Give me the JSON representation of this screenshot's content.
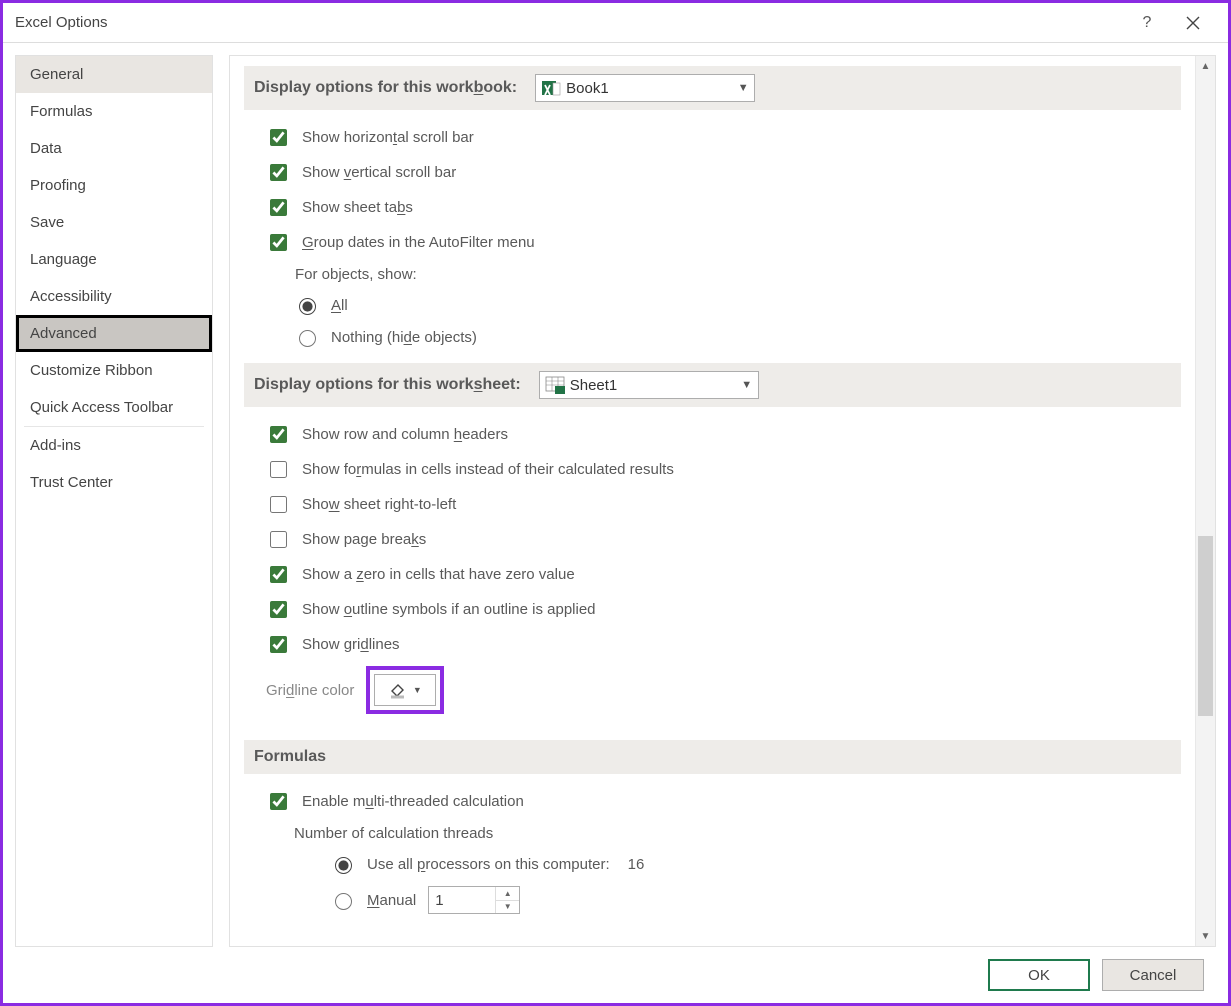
{
  "titlebar": {
    "title": "Excel Options"
  },
  "nav": {
    "general": "General",
    "formulas": "Formulas",
    "data": "Data",
    "proofing": "Proofing",
    "save": "Save",
    "language": "Language",
    "accessibility": "Accessibility",
    "advanced": "Advanced",
    "customize_ribbon": "Customize Ribbon",
    "qat": "Quick Access Toolbar",
    "addins": "Add-ins",
    "trust_center": "Trust Center"
  },
  "sec_workbook": {
    "title_a": "Display options for this work",
    "title_u": "b",
    "title_b": "ook:",
    "selected": "Book1",
    "show_h_scroll_a": "Show horizon",
    "show_h_scroll_u": "t",
    "show_h_scroll_b": "al scroll bar",
    "show_v_scroll_a": "Show ",
    "show_v_scroll_u": "v",
    "show_v_scroll_b": "ertical scroll bar",
    "show_tabs_a": "Show sheet ta",
    "show_tabs_u": "b",
    "show_tabs_b": "s",
    "group_dates_u": "G",
    "group_dates_b": "roup dates in the AutoFilter menu",
    "for_objects": "For objects, show:",
    "all_u": "A",
    "all_b": "ll",
    "nothing_a": "Nothing (hi",
    "nothing_u": "d",
    "nothing_b": "e objects)"
  },
  "sec_worksheet": {
    "title_a": "Display options for this work",
    "title_u": "s",
    "title_b": "heet:",
    "selected": "Sheet1",
    "row_col_a": "Show row and column ",
    "row_col_u": "h",
    "row_col_b": "eaders",
    "show_formulas_a": "Show fo",
    "show_formulas_u": "r",
    "show_formulas_b": "mulas in cells instead of their calculated results",
    "rtl_a": "Sho",
    "rtl_u": "w",
    "rtl_b": " sheet right-to-left",
    "page_breaks_a": "Show page brea",
    "page_breaks_u": "k",
    "page_breaks_b": "s",
    "zero_a": "Show a ",
    "zero_u": "z",
    "zero_b": "ero in cells that have zero value",
    "outline_a": "Show ",
    "outline_u": "o",
    "outline_b": "utline symbols if an outline is applied",
    "gridlines_a": "Show gri",
    "gridlines_u": "d",
    "gridlines_b": "lines",
    "gridline_color_a": "Gri",
    "gridline_color_u": "d",
    "gridline_color_b": "line color"
  },
  "sec_formulas": {
    "title": "Formulas",
    "multi_thread_a": "Enable m",
    "multi_thread_u": "u",
    "multi_thread_b": "lti-threaded calculation",
    "num_threads": "Number of calculation threads",
    "use_all_a": "Use all ",
    "use_all_u": "p",
    "use_all_b": "rocessors on this computer:",
    "proc_count": "16",
    "manual_u": "M",
    "manual_b": "anual",
    "manual_value": "1"
  },
  "footer": {
    "ok": "OK",
    "cancel": "Cancel"
  }
}
